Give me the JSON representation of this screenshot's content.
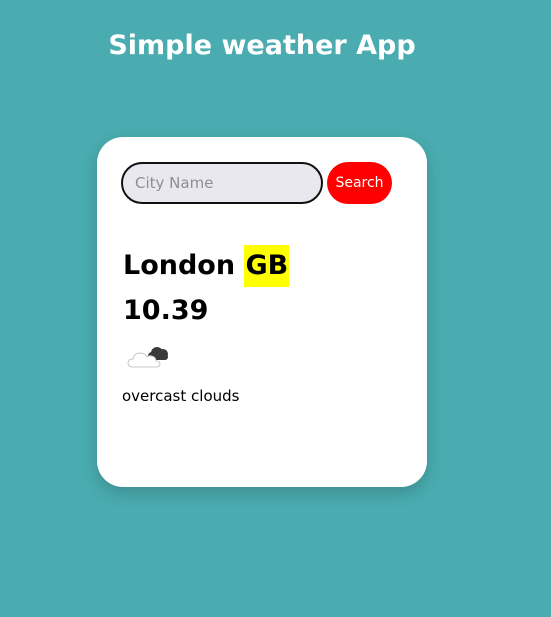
{
  "app": {
    "title": "Simple weather App"
  },
  "search": {
    "placeholder": "City Name",
    "value": "",
    "button_label": "Search"
  },
  "weather": {
    "city": "London",
    "country": "GB",
    "temperature": "10.39",
    "icon": "overcast-clouds-icon",
    "description": "overcast clouds"
  },
  "colors": {
    "background": "#4aacb0",
    "card": "#ffffff",
    "search_button": "#ff0000",
    "country_highlight": "#ffff00",
    "input_background": "#e9e8ee"
  }
}
